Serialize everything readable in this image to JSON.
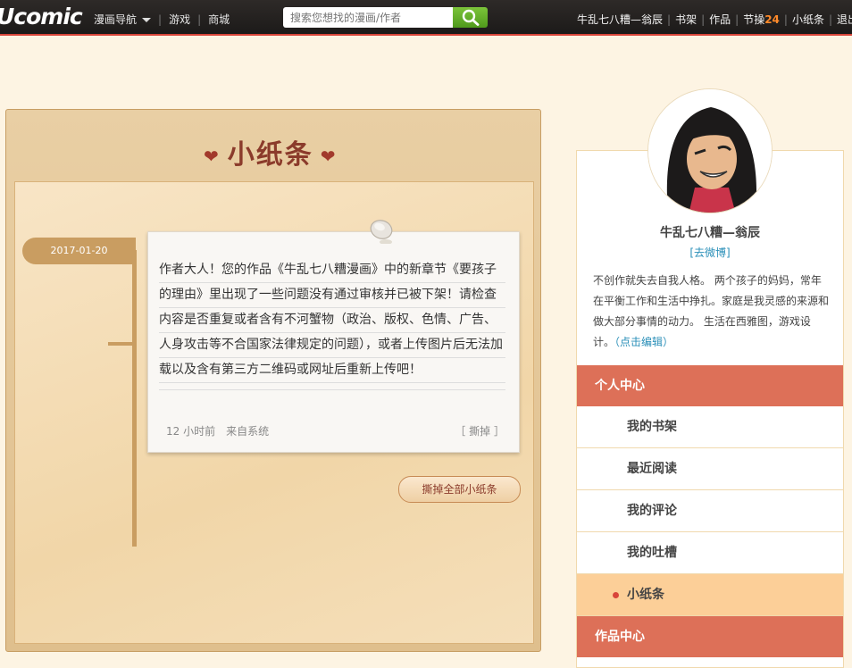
{
  "header": {
    "logo": "Ucomic",
    "nav": [
      "漫画导航",
      "游戏",
      "商城"
    ],
    "search_placeholder": "搜索您想找的漫画/作者",
    "user_links": {
      "username": "牛乱七八糟—翁辰",
      "bookshelf": "书架",
      "works": "作品",
      "tucao": "节操",
      "tucao_count": "24",
      "notes": "小纸条",
      "logout": "退出"
    }
  },
  "board": {
    "title": "小纸条",
    "note": {
      "date": "2017-01-20",
      "text": "作者大人！您的作品《牛乱七八糟漫画》中的新章节《要孩子的理由》里出现了一些问题没有通过审核并已被下架！请检查内容是否重复或者含有不河蟹物（政治、版权、色情、广告、人身攻击等不合国家法律规定的问题），或者上传图片后无法加载以及含有第三方二维码或网址后重新上传吧！",
      "time_ago": "12 小时前",
      "source": "来自系统",
      "delete_label": "［ 撕掉 ］"
    },
    "delete_all_label": "撕掉全部小纸条"
  },
  "sidebar": {
    "username": "牛乱七八糟—翁辰",
    "weibo_link": "[去微博]",
    "bio": "不创作就失去自我人格。 两个孩子的妈妈，常年在平衡工作和生活中挣扎。家庭是我灵感的来源和做大部分事情的动力。 生活在西雅图，游戏设计。",
    "edit_link": "（点击编辑）",
    "section_personal": "个人中心",
    "items": [
      {
        "label": "我的书架"
      },
      {
        "label": "最近阅读"
      },
      {
        "label": "我的评论"
      },
      {
        "label": "我的吐槽"
      },
      {
        "label": "小纸条"
      }
    ],
    "section_works": "作品中心"
  },
  "colors": {
    "accent_red": "#d8453a",
    "menu_head": "#dd7058",
    "menu_active": "#fccf98",
    "link_blue": "#2a8fb8"
  }
}
